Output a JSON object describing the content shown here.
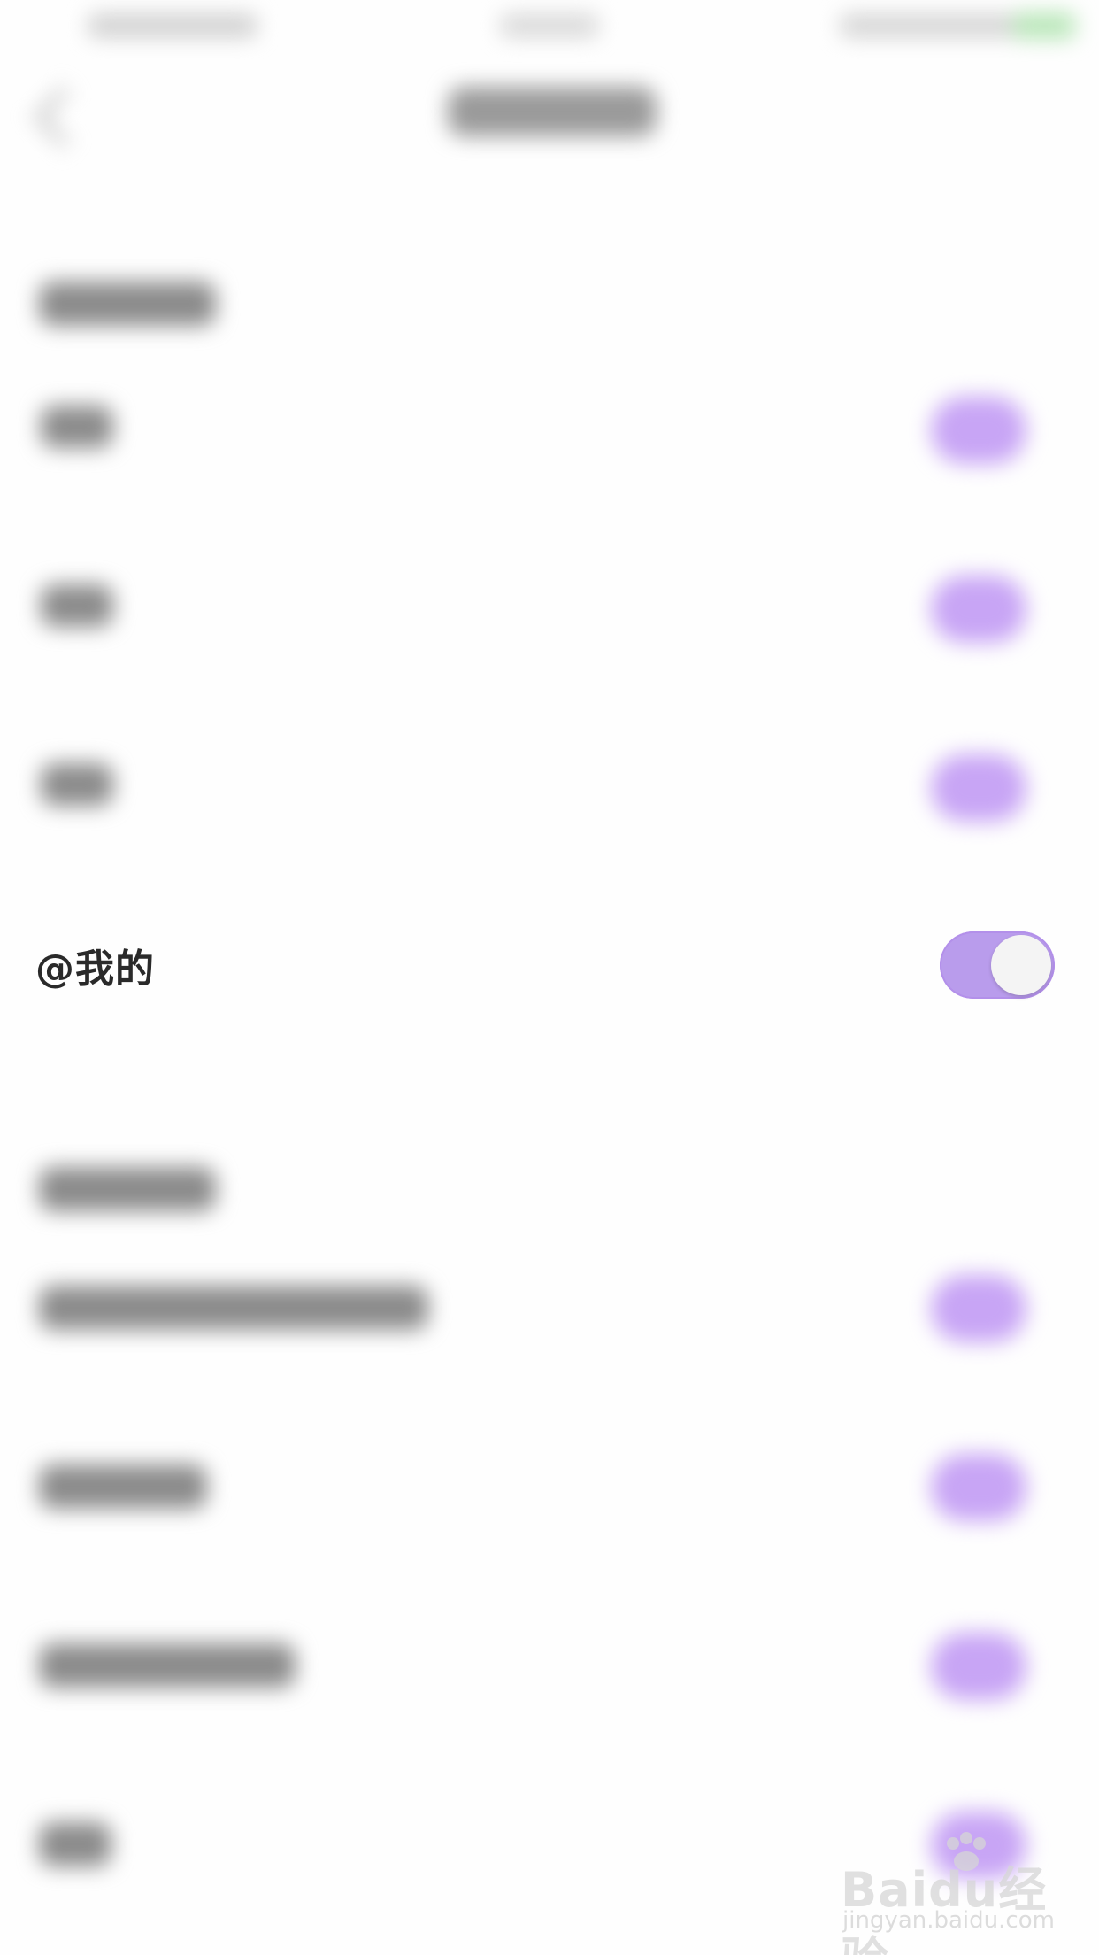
{
  "row": {
    "label": "@我的",
    "toggle_on": true
  },
  "colors": {
    "toggle_track": "#b99cec",
    "toggle_knob": "#f4f4f4",
    "accent_purple": "#c8a5f5",
    "battery_green": "#b8e6b8"
  },
  "watermark": {
    "brand": "Baidu经验",
    "domain": "jingyan.baidu.com"
  }
}
